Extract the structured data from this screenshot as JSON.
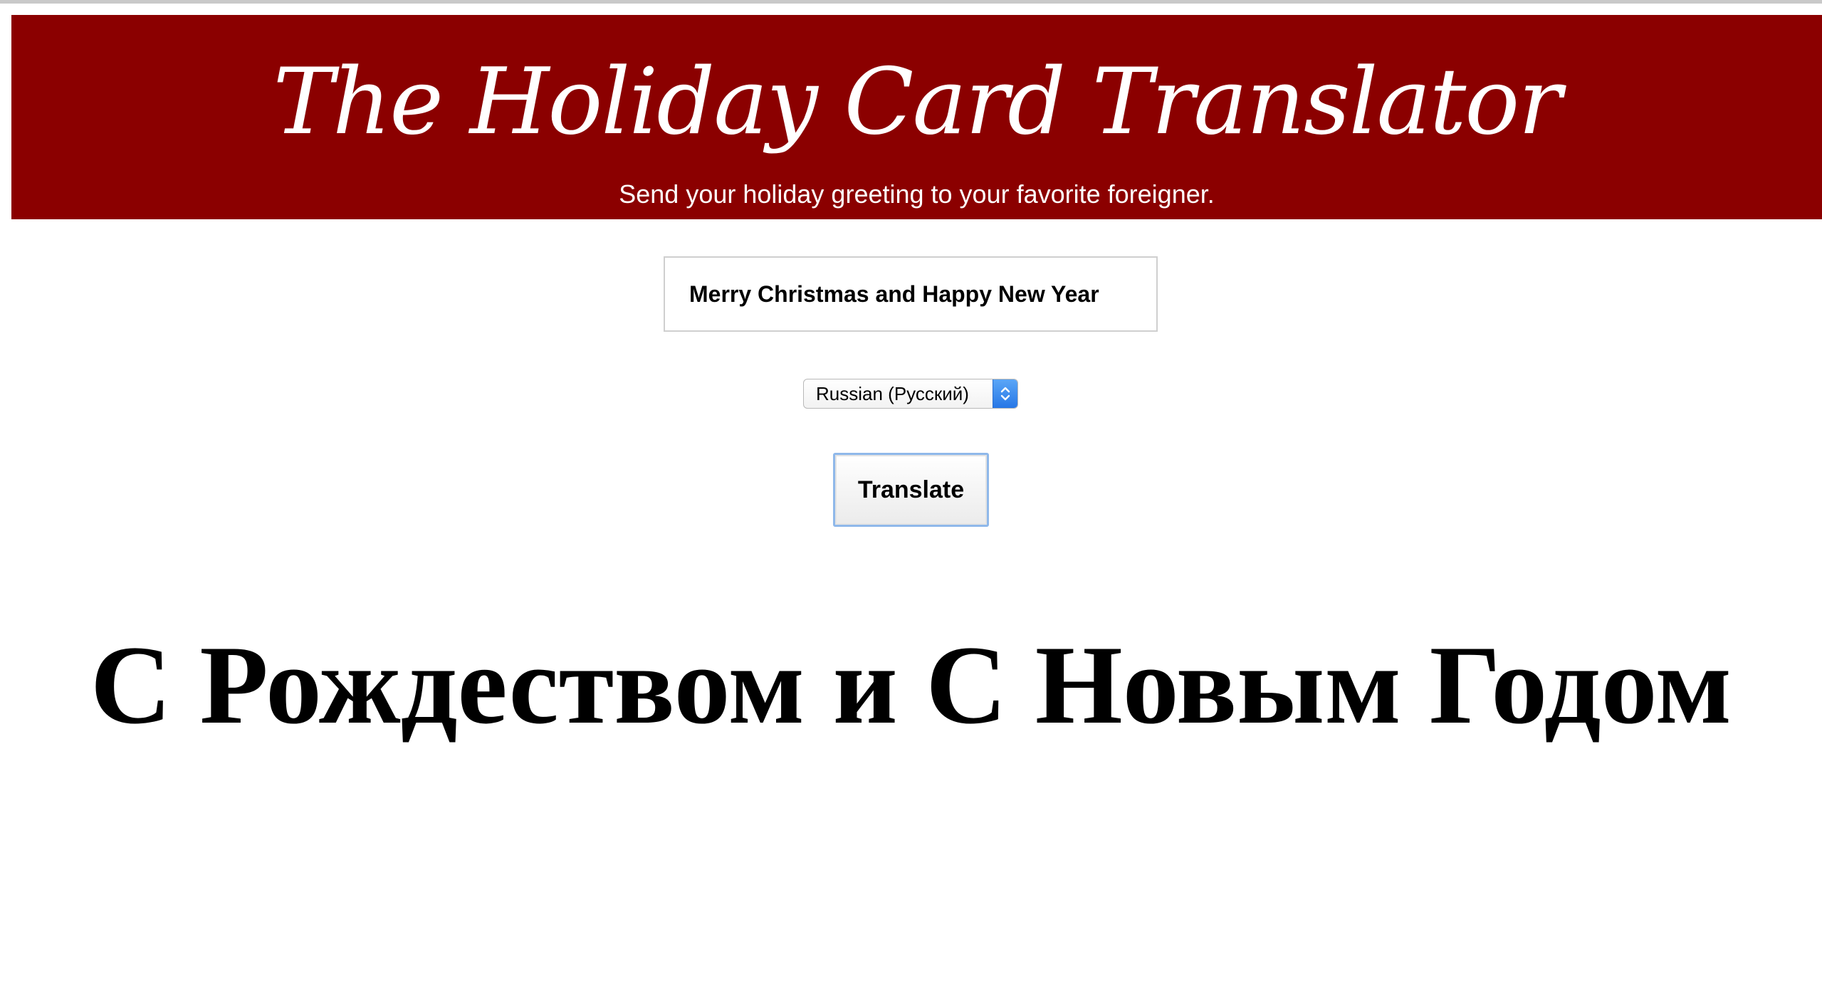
{
  "header": {
    "title": "The Holiday Card Translator",
    "subtitle": "Send your holiday greeting to your favorite foreigner.",
    "background_color": "#8b0000"
  },
  "form": {
    "message_value": "Merry Christmas and Happy New Year",
    "language_selected": "Russian (Русский)",
    "select_icon": "chevron-up-down-icon",
    "translate_label": "Translate",
    "accent_color": "#2f86ee"
  },
  "result": {
    "translation": "С Рождеством и С Новым Годом"
  }
}
